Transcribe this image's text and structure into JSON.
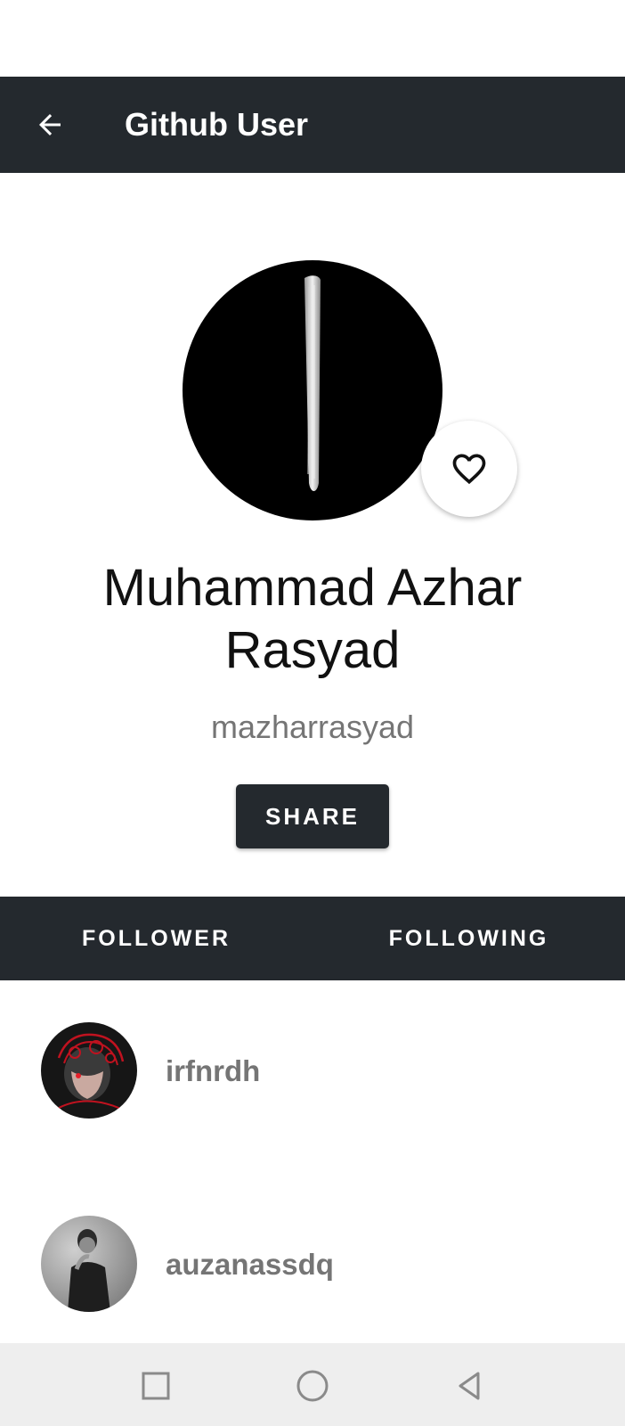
{
  "appbar": {
    "title": "Github User",
    "back_icon": "arrow-back-icon"
  },
  "profile": {
    "full_name": "Muhammad Azhar Rasyad",
    "username": "mazharrasyad",
    "favorite_icon": "heart-outline-icon",
    "share_label": "SHARE"
  },
  "tabs": [
    {
      "label": "FOLLOWER"
    },
    {
      "label": "FOLLOWING"
    }
  ],
  "followers": [
    {
      "username": "irfnrdh"
    },
    {
      "username": "auzanassdq"
    }
  ],
  "navbar": {
    "recents_icon": "square-icon",
    "home_icon": "circle-icon",
    "back_icon": "triangle-back-icon"
  },
  "colors": {
    "primary": "#24292e",
    "secondary_text": "#757575",
    "navbar_bg": "#eeeeee"
  }
}
